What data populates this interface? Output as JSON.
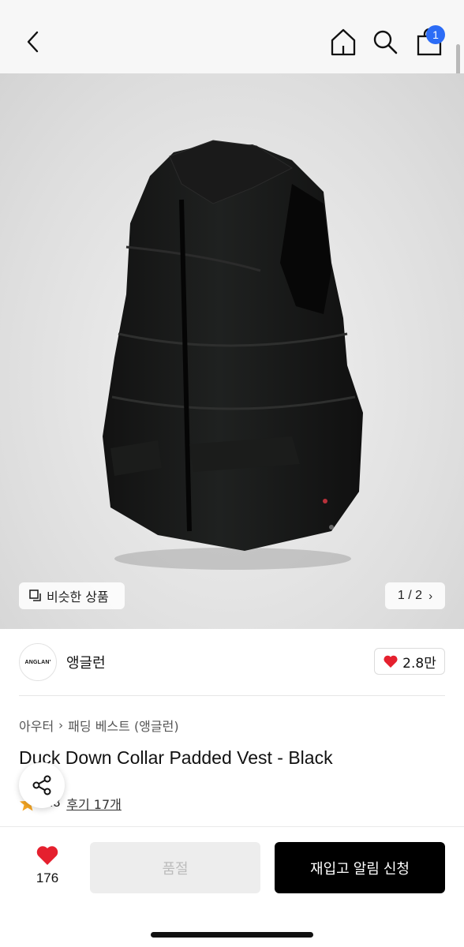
{
  "header": {
    "back_icon": "chevron-left-icon",
    "home_icon": "home-icon",
    "search_icon": "search-icon",
    "cart_icon": "shopping-bag-icon",
    "cart_badge": "1",
    "badge_color": "#2c6cf6"
  },
  "gallery": {
    "similar_label": "비슷한 상품",
    "pager": "1 / 2"
  },
  "brand": {
    "logo_text": "ANGLAN'",
    "name": "앵글런",
    "likes": "2.8만"
  },
  "breadcrumb": [
    "아우터",
    "패딩 베스트 (앵글런)"
  ],
  "product": {
    "title": "Duck Down Collar Padded Vest - Black",
    "rating": "4.8",
    "reviews": "후기 17개"
  },
  "bottom_bar": {
    "wish_count": "176",
    "soldout_label": "품절",
    "restock_label": "재입고 알림 신청"
  },
  "colors": {
    "heart": "#e5202e",
    "star": "#f5a623",
    "primary_button": "#000000"
  }
}
